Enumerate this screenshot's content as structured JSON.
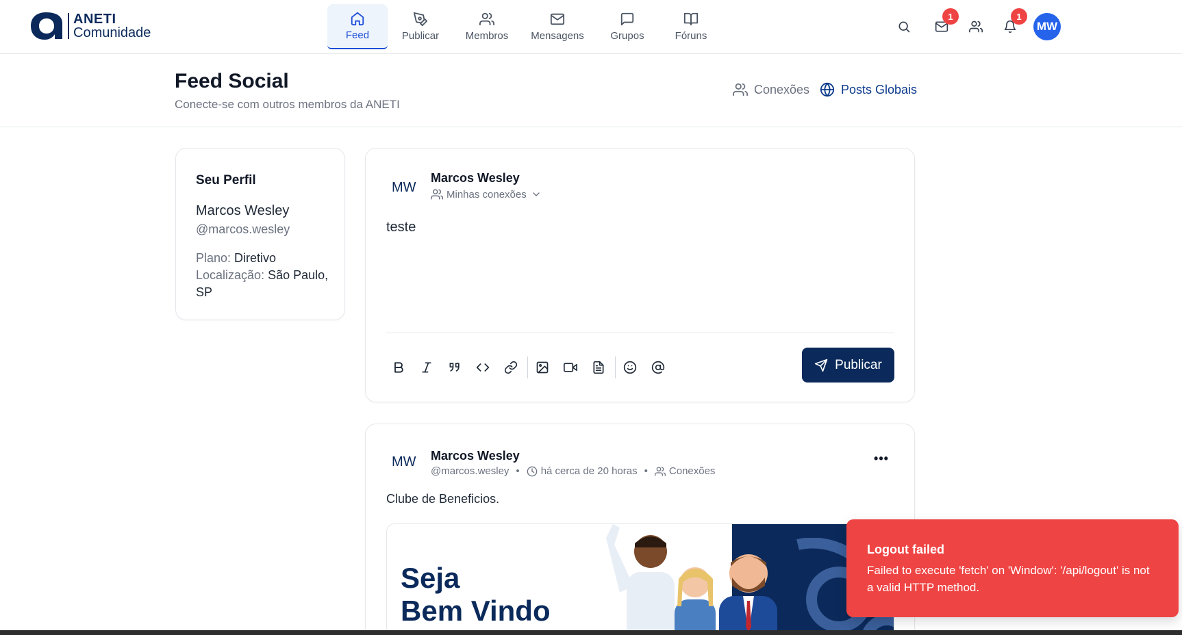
{
  "brand": {
    "line1": "ANETI",
    "line2": "Comunidade",
    "color": "#0b2a5b"
  },
  "nav": {
    "tabs": [
      {
        "label": "Feed",
        "icon": "home-icon",
        "active": true
      },
      {
        "label": "Publicar",
        "icon": "pen-nib-icon"
      },
      {
        "label": "Membros",
        "icon": "users-icon"
      },
      {
        "label": "Mensagens",
        "icon": "mail-icon"
      },
      {
        "label": "Grupos",
        "icon": "chat-icon"
      },
      {
        "label": "Fóruns",
        "icon": "book-open-icon"
      }
    ],
    "messages_badge": "1",
    "notifications_badge": "1",
    "avatar_initials": "MW"
  },
  "header": {
    "title": "Feed Social",
    "subtitle": "Conecte-se com outros membros da ANETI",
    "link_connections": "Conexões",
    "link_global": "Posts Globais"
  },
  "profile": {
    "title": "Seu Perfil",
    "name": "Marcos Wesley",
    "handle": "@marcos.wesley",
    "plan_label": "Plano: ",
    "plan_value": "Diretivo",
    "location_label": "Localização: ",
    "location_value": "São Paulo, SP"
  },
  "composer": {
    "initials": "MW",
    "author": "Marcos Wesley",
    "audience": "Minhas conexões",
    "text": "teste",
    "publish_label": "Publicar"
  },
  "post": {
    "initials": "MW",
    "author": "Marcos Wesley",
    "handle": "@marcos.wesley",
    "time": "há cerca de 20 horas",
    "visibility": "Conexões",
    "body": "Clube de Beneficios.",
    "banner_line1": "Seja",
    "banner_line2": "Bem Vindo"
  },
  "toast": {
    "title": "Logout failed",
    "message": "Failed to execute 'fetch' on 'Window': '/api/logout' is not a valid HTTP method.",
    "color": "#ef4444"
  }
}
